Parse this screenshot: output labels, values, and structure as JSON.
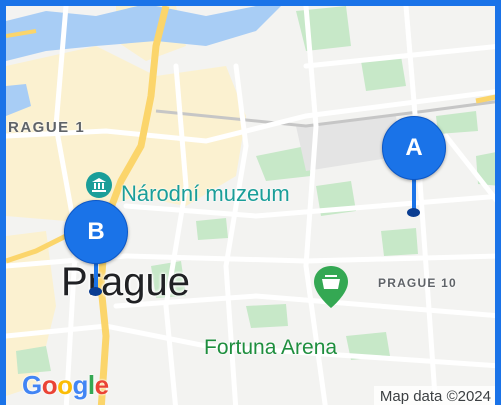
{
  "map": {
    "district_north": "RAGUE 1",
    "district_east": "PRAGUE 10",
    "city": "Prague",
    "poi_museum": "Národní muzeum",
    "poi_arena": "Fortuna Arena",
    "markers": [
      {
        "label": "A"
      },
      {
        "label": "B"
      }
    ],
    "attribution": "Map data ©2024",
    "logo": [
      "G",
      "o",
      "o",
      "g",
      "l",
      "e"
    ]
  },
  "colors": {
    "marker": "#1a73e8",
    "water": "#a8cdf5",
    "park": "#c7e8c8",
    "urban": "#fbf1d0",
    "road_major": "#fbd56b",
    "logo": [
      "#4285f4",
      "#ea4335",
      "#fbbc05",
      "#4285f4",
      "#34a853",
      "#ea4335"
    ]
  },
  "icons": {
    "museum": "museum-icon",
    "arena": "stadium-icon"
  }
}
